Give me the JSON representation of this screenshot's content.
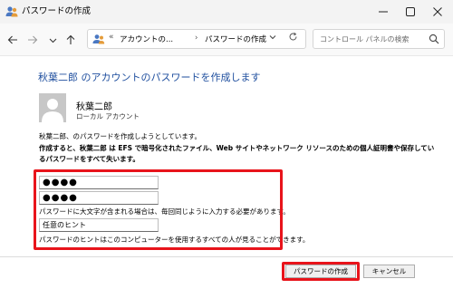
{
  "window": {
    "title": "パスワードの作成",
    "minimize_icon": "minimize-icon",
    "maximize_icon": "maximize-icon",
    "close_icon": "close-icon"
  },
  "nav": {
    "back_icon": "arrow-left-icon",
    "forward_icon": "arrow-right-icon",
    "recent_icon": "chevron-down-icon",
    "up_icon": "arrow-up-icon"
  },
  "address_bar": {
    "overflow_marker": "«",
    "breadcrumbs": [
      "アカウントの...",
      "パスワードの作成"
    ],
    "separator": "›",
    "refresh_icon": "refresh-icon"
  },
  "search": {
    "placeholder": "コントロール パネルの検索",
    "icon": "search-icon"
  },
  "content": {
    "heading": "秋葉二郎 のアカウントのパスワードを作成します",
    "user": {
      "name": "秋葉二郎",
      "account_type": "ローカル アカウント"
    },
    "info": "秋葉二郎、のパスワードを作成しようとしています。",
    "warning": "作成すると、秋葉二郎 は EFS で暗号化されたファイル、Web サイトやネットワーク リソースのための個人証明書や保存しているパスワードをすべて失います。",
    "password_value": "●●●●",
    "confirm_value": "●●●●",
    "case_note": "パスワードに大文字が含まれる場合は、毎回同じように入力する必要があります。",
    "hint_value": "任意のヒント",
    "hint_note": "パスワードのヒントはこのコンピューターを使用するすべての人が見ることができます。"
  },
  "buttons": {
    "create": "パスワードの作成",
    "cancel": "キャンセル"
  },
  "colors": {
    "heading": "#1e4e9e",
    "highlight": "#e8141b"
  }
}
